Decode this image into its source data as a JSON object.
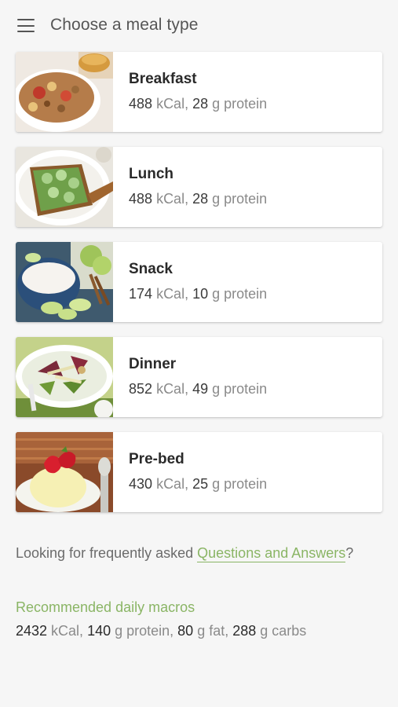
{
  "header": {
    "title": "Choose a meal type",
    "menu_icon": "hamburger-menu-icon"
  },
  "meals": [
    {
      "name": "Breakfast",
      "kcal": "488",
      "kcal_unit": "kCal,",
      "protein": "28",
      "protein_unit": "g protein",
      "image": "granola-bowl-image"
    },
    {
      "name": "Lunch",
      "kcal": "488",
      "kcal_unit": "kCal,",
      "protein": "28",
      "protein_unit": "g protein",
      "image": "cucumber-toast-image"
    },
    {
      "name": "Snack",
      "kcal": "174",
      "kcal_unit": "kCal,",
      "protein": "10",
      "protein_unit": "g protein",
      "image": "yogurt-apples-image"
    },
    {
      "name": "Dinner",
      "kcal": "852",
      "kcal_unit": "kCal,",
      "protein": "49",
      "protein_unit": "g protein",
      "image": "salad-plate-image"
    },
    {
      "name": "Pre-bed",
      "kcal": "430",
      "kcal_unit": "kCal,",
      "protein": "25",
      "protein_unit": "g protein",
      "image": "strawberry-dessert-image"
    }
  ],
  "faq": {
    "prefix": "Looking for frequently asked ",
    "link": "Questions and Answers",
    "suffix": "?"
  },
  "recommended": {
    "heading": "Recommended daily macros",
    "kcal": "2432",
    "kcal_unit": " kCal, ",
    "protein": "140",
    "protein_unit": " g protein, ",
    "fat": "80",
    "fat_unit": " g fat, ",
    "carbs": "288",
    "carbs_unit": " g carbs"
  },
  "colors": {
    "accent": "#8ab565",
    "background": "#f6f6f6",
    "card": "#ffffff"
  }
}
